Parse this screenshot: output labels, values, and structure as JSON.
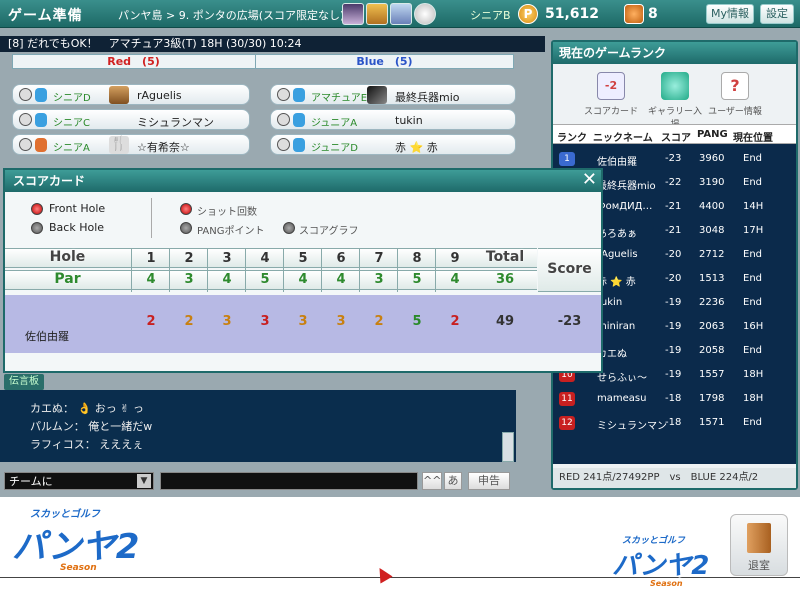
{
  "topbar": {
    "title": "ゲーム準備",
    "breadcrumb": "パンヤ島 > 9. ポンタの広場(スコア限定なし)",
    "rank": "シニアB",
    "pang_symbol": "P",
    "pang": "51,612",
    "cookies": "8",
    "myinfo_label": "My情報",
    "settings_label": "設定"
  },
  "room": {
    "info": "[8] だれでもOK！　アマチュア3級(T) 18H (30/30) 10:24"
  },
  "teams": {
    "red": "Red　(5)",
    "blue": "Blue　(5)"
  },
  "players_red": [
    {
      "rank": "シニアD",
      "name": "rAguelis"
    },
    {
      "rank": "シニアC",
      "name": "ミシュランマン"
    },
    {
      "rank": "シニアA",
      "name": "☆有希奈☆"
    }
  ],
  "players_blue": [
    {
      "rank": "アマチュアE",
      "name": "最終兵器mio"
    },
    {
      "rank": "ジュニアA",
      "name": "tukin"
    },
    {
      "rank": "ジュニアD",
      "name": "赤 ⭐ 赤"
    }
  ],
  "scorecard": {
    "title": "スコアカード",
    "close": "✕",
    "options_left": [
      "Front Hole",
      "Back Hole"
    ],
    "options_right": [
      "ショット回数",
      "PANGポイント",
      "スコアグラフ"
    ],
    "hole_label": "Hole",
    "par_label": "Par",
    "total_label": "Total",
    "score_label": "Score",
    "holes": [
      "1",
      "2",
      "3",
      "4",
      "5",
      "6",
      "7",
      "8",
      "9"
    ],
    "pars": [
      "4",
      "3",
      "4",
      "5",
      "4",
      "4",
      "3",
      "5",
      "4"
    ],
    "par_total": "36",
    "player_name": "佐伯由羅",
    "strokes": [
      "2",
      "2",
      "3",
      "3",
      "3",
      "3",
      "2",
      "5",
      "2"
    ],
    "stroke_total": "49",
    "score": "-23"
  },
  "ranking": {
    "title": "現在のゲームランク",
    "icons": [
      "スコアカード",
      "ギャラリー入場",
      "ユーザー情報"
    ],
    "scorecard_icon_text": "-2",
    "columns": [
      "ランク",
      "ニックネーム",
      "スコア",
      "PANG",
      "現在位置"
    ],
    "rows": [
      {
        "rank": "1",
        "name": "佐伯由羅",
        "score": "-23",
        "pang": "3960",
        "pos": "End"
      },
      {
        "rank": "2",
        "name": "最終兵器mio",
        "score": "-22",
        "pang": "3190",
        "pos": "End"
      },
      {
        "rank": "3",
        "name": "ФомДИД…",
        "score": "-21",
        "pang": "4400",
        "pos": "14H"
      },
      {
        "rank": "4",
        "name": "あろあぁ",
        "score": "-21",
        "pang": "3048",
        "pos": "17H"
      },
      {
        "rank": "5",
        "name": "rAguelis",
        "score": "-20",
        "pang": "2712",
        "pos": "End"
      },
      {
        "rank": "6",
        "name": "赤 ⭐ 赤",
        "score": "-20",
        "pang": "1513",
        "pos": "End"
      },
      {
        "rank": "7",
        "name": "tukin",
        "score": "-19",
        "pang": "2236",
        "pos": "End"
      },
      {
        "rank": "8",
        "name": "miniran",
        "score": "-19",
        "pang": "2063",
        "pos": "16H"
      },
      {
        "rank": "9",
        "name": "カエぬ",
        "score": "-19",
        "pang": "2058",
        "pos": "End"
      },
      {
        "rank": "10",
        "name": "せらふぃ〜",
        "score": "-19",
        "pang": "1557",
        "pos": "18H"
      },
      {
        "rank": "11",
        "name": "mameasu",
        "score": "-18",
        "pang": "1798",
        "pos": "18H"
      },
      {
        "rank": "12",
        "name": "ミシュランマン",
        "score": "-18",
        "pang": "1571",
        "pos": "End"
      }
    ],
    "footer": "RED 241点/27492PP　vs　BLUE 224点/2"
  },
  "chat": {
    "label": "伝言板",
    "lines": [
      "カエぬ： 👌 おっ ✌ っ",
      "パルムン： 俺と一緒だw",
      "ラフィコス： えええぇ"
    ],
    "channel": "チームに",
    "ime_a": "^^",
    "ime_b": "あ",
    "report": "申告"
  },
  "bottom": {
    "logo_top": "スカッとゴルフ",
    "logo_main": "パンヤ2",
    "logo_sub": "Season",
    "exit": "退室"
  },
  "colors": {
    "accent": "#1e6a6a",
    "red_team": "#d02222",
    "blue_team": "#2a54c8",
    "chat_bg": "#0a2d4d"
  }
}
